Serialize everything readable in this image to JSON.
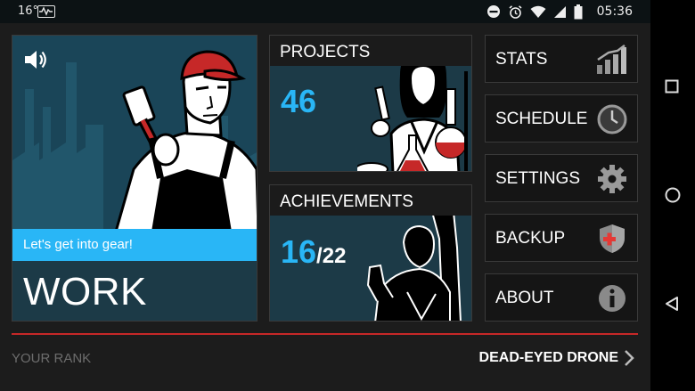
{
  "status_bar": {
    "temperature": "16°",
    "time": "05:36"
  },
  "tiles": {
    "work": {
      "tagline": "Let's get into gear!",
      "title": "WORK"
    },
    "projects": {
      "label": "PROJECTS",
      "count": "46"
    },
    "achievements": {
      "label": "ACHIEVEMENTS",
      "earned": "16",
      "total": "/22"
    }
  },
  "menu": [
    {
      "label": "STATS",
      "icon": "bar-chart-icon"
    },
    {
      "label": "SCHEDULE",
      "icon": "clock-icon"
    },
    {
      "label": "SETTINGS",
      "icon": "gear-icon"
    },
    {
      "label": "BACKUP",
      "icon": "shield-icon"
    },
    {
      "label": "ABOUT",
      "icon": "info-icon"
    }
  ],
  "rank": {
    "label": "YOUR RANK",
    "value": "DEAD-EYED DRONE"
  },
  "colors": {
    "accent_blue": "#29b6f6",
    "tile_background": "#1c3a47",
    "rank_line": "#c62828"
  }
}
